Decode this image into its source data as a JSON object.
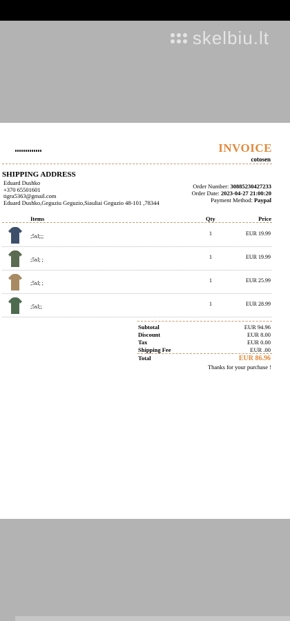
{
  "watermark": {
    "text": "skelbiu.lt"
  },
  "invoice": {
    "title": "INVOICE",
    "shop": "cotosen",
    "shipping_heading": "SHIPPING ADDRESS",
    "customer": {
      "name": "Eduard Dushko",
      "phone": "+370 65501601",
      "email": "tigra5363@gmail.com",
      "address": "Eduard Dushko,Geguziu Geguzio,Siauliai Geguzio 48-101 ,78344"
    },
    "order": {
      "number_label": "Order Number:",
      "number": "30885230427233",
      "date_label": "Order Date:",
      "date": "2023-04-27 21:00:20",
      "payment_label": "Payment Method:",
      "payment": "Paypal"
    },
    "columns": {
      "items": "Items",
      "qty": "Qty",
      "price": "Price"
    },
    "items": [
      {
        "name": ";5xl;;;",
        "qty": "1",
        "price": "EUR 19.99",
        "thumb_icon": "shirt-icon",
        "color": "#3d4f6a"
      },
      {
        "name": ";5xl; ;",
        "qty": "1",
        "price": "EUR 19.99",
        "thumb_icon": "shirt-icon",
        "color": "#5b6b52"
      },
      {
        "name": ";5xl; ;",
        "qty": "1",
        "price": "EUR 25.99",
        "thumb_icon": "shirt-icon",
        "color": "#a88a63"
      },
      {
        "name": ";5xl;;",
        "qty": "1",
        "price": "EUR 28.99",
        "thumb_icon": "shirt-icon",
        "color": "#4e6b4f"
      }
    ],
    "totals": {
      "subtotal_label": "Subtotal",
      "subtotal": "EUR 94.96",
      "discount_label": "Discount",
      "discount": "EUR 8.00",
      "tax_label": "Tax",
      "tax": "EUR 0.00",
      "shipping_label": "Shipping Fee",
      "shipping": "EUR .00",
      "total_label": "Total",
      "total": "EUR 86.96"
    },
    "thanks": "Thanks for your purchase !",
    "accent_color": "#e08a3a"
  }
}
